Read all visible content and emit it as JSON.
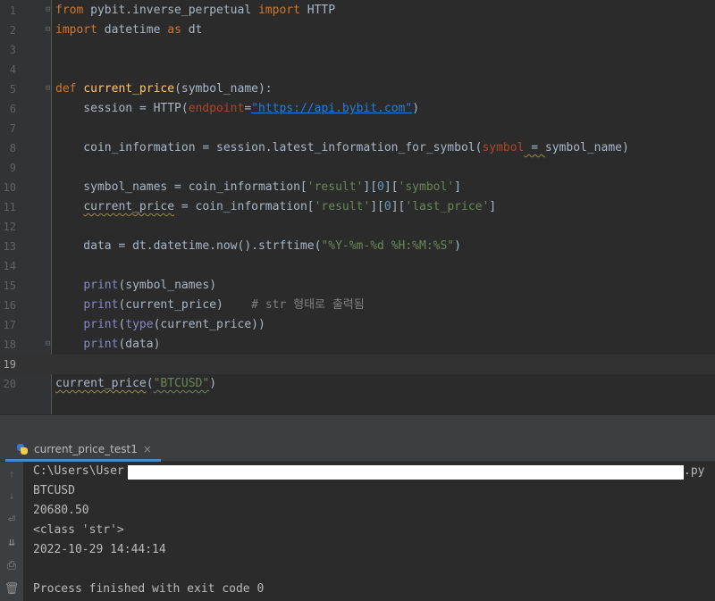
{
  "editor": {
    "line_numbers": [
      "1",
      "2",
      "3",
      "4",
      "5",
      "6",
      "7",
      "8",
      "9",
      "10",
      "11",
      "12",
      "13",
      "14",
      "15",
      "16",
      "17",
      "18",
      "19",
      "20"
    ],
    "l1": {
      "kw1": "from",
      "mod": " pybit.inverse_perpetual ",
      "kw2": "import",
      "rest": " HTTP"
    },
    "l2": {
      "kw1": "import",
      "mod": " datetime ",
      "kw2": "as",
      "rest": " dt"
    },
    "l5": {
      "kw": "def",
      "fn": "current_price",
      "rest": "(symbol_name):"
    },
    "l6": {
      "pre": "    session = HTTP(",
      "param": "endpoint",
      "eq": "=",
      "str": "\"https://api.bybit.com\"",
      "post": ")"
    },
    "l8": {
      "pre": "    coin_information = session.latest_information_for_symbol(",
      "param": "symbol",
      "eq": " = ",
      "post": "symbol_name)"
    },
    "l10": {
      "pre": "    symbol_names = coin_information[",
      "s1": "'result'",
      "m1": "][",
      "n1": "0",
      "m2": "][",
      "s2": "'symbol'",
      "post": "]"
    },
    "l11": {
      "var": "current_price",
      "pre": " = coin_information[",
      "s1": "'result'",
      "m1": "][",
      "n1": "0",
      "m2": "][",
      "s2": "'last_price'",
      "post": "]"
    },
    "l13": {
      "pre": "    data = dt.datetime.now().strftime(",
      "str": "\"%Y-%m-%d %H:%M:%S\"",
      "post": ")"
    },
    "l15": {
      "bi": "print",
      "post": "(symbol_names)"
    },
    "l16": {
      "bi": "print",
      "post": "(current_price)    ",
      "cmt": "# str 형태로 출력됨"
    },
    "l17": {
      "bi": "print",
      "m": "(",
      "bi2": "type",
      "post": "(current_price))"
    },
    "l18": {
      "bi": "print",
      "post": "(data)"
    },
    "l20": {
      "call": "current_price",
      "m": "(",
      "str": "\"BTCUSD\"",
      "post": ")"
    }
  },
  "run_tab": {
    "label": "current_price_test1",
    "close": "×"
  },
  "console": {
    "path_prefix": "C:\\Users\\User",
    "path_suffix": ".py",
    "lines": [
      "BTCUSD",
      "20680.50",
      "<class 'str'>",
      "2022-10-29 14:44:14",
      "",
      "Process finished with exit code 0"
    ]
  },
  "tools": {
    "up": "↑",
    "down": "↓",
    "wrap": "⏎",
    "sort": "⇊",
    "print": "⎙",
    "trash": "🗑"
  }
}
